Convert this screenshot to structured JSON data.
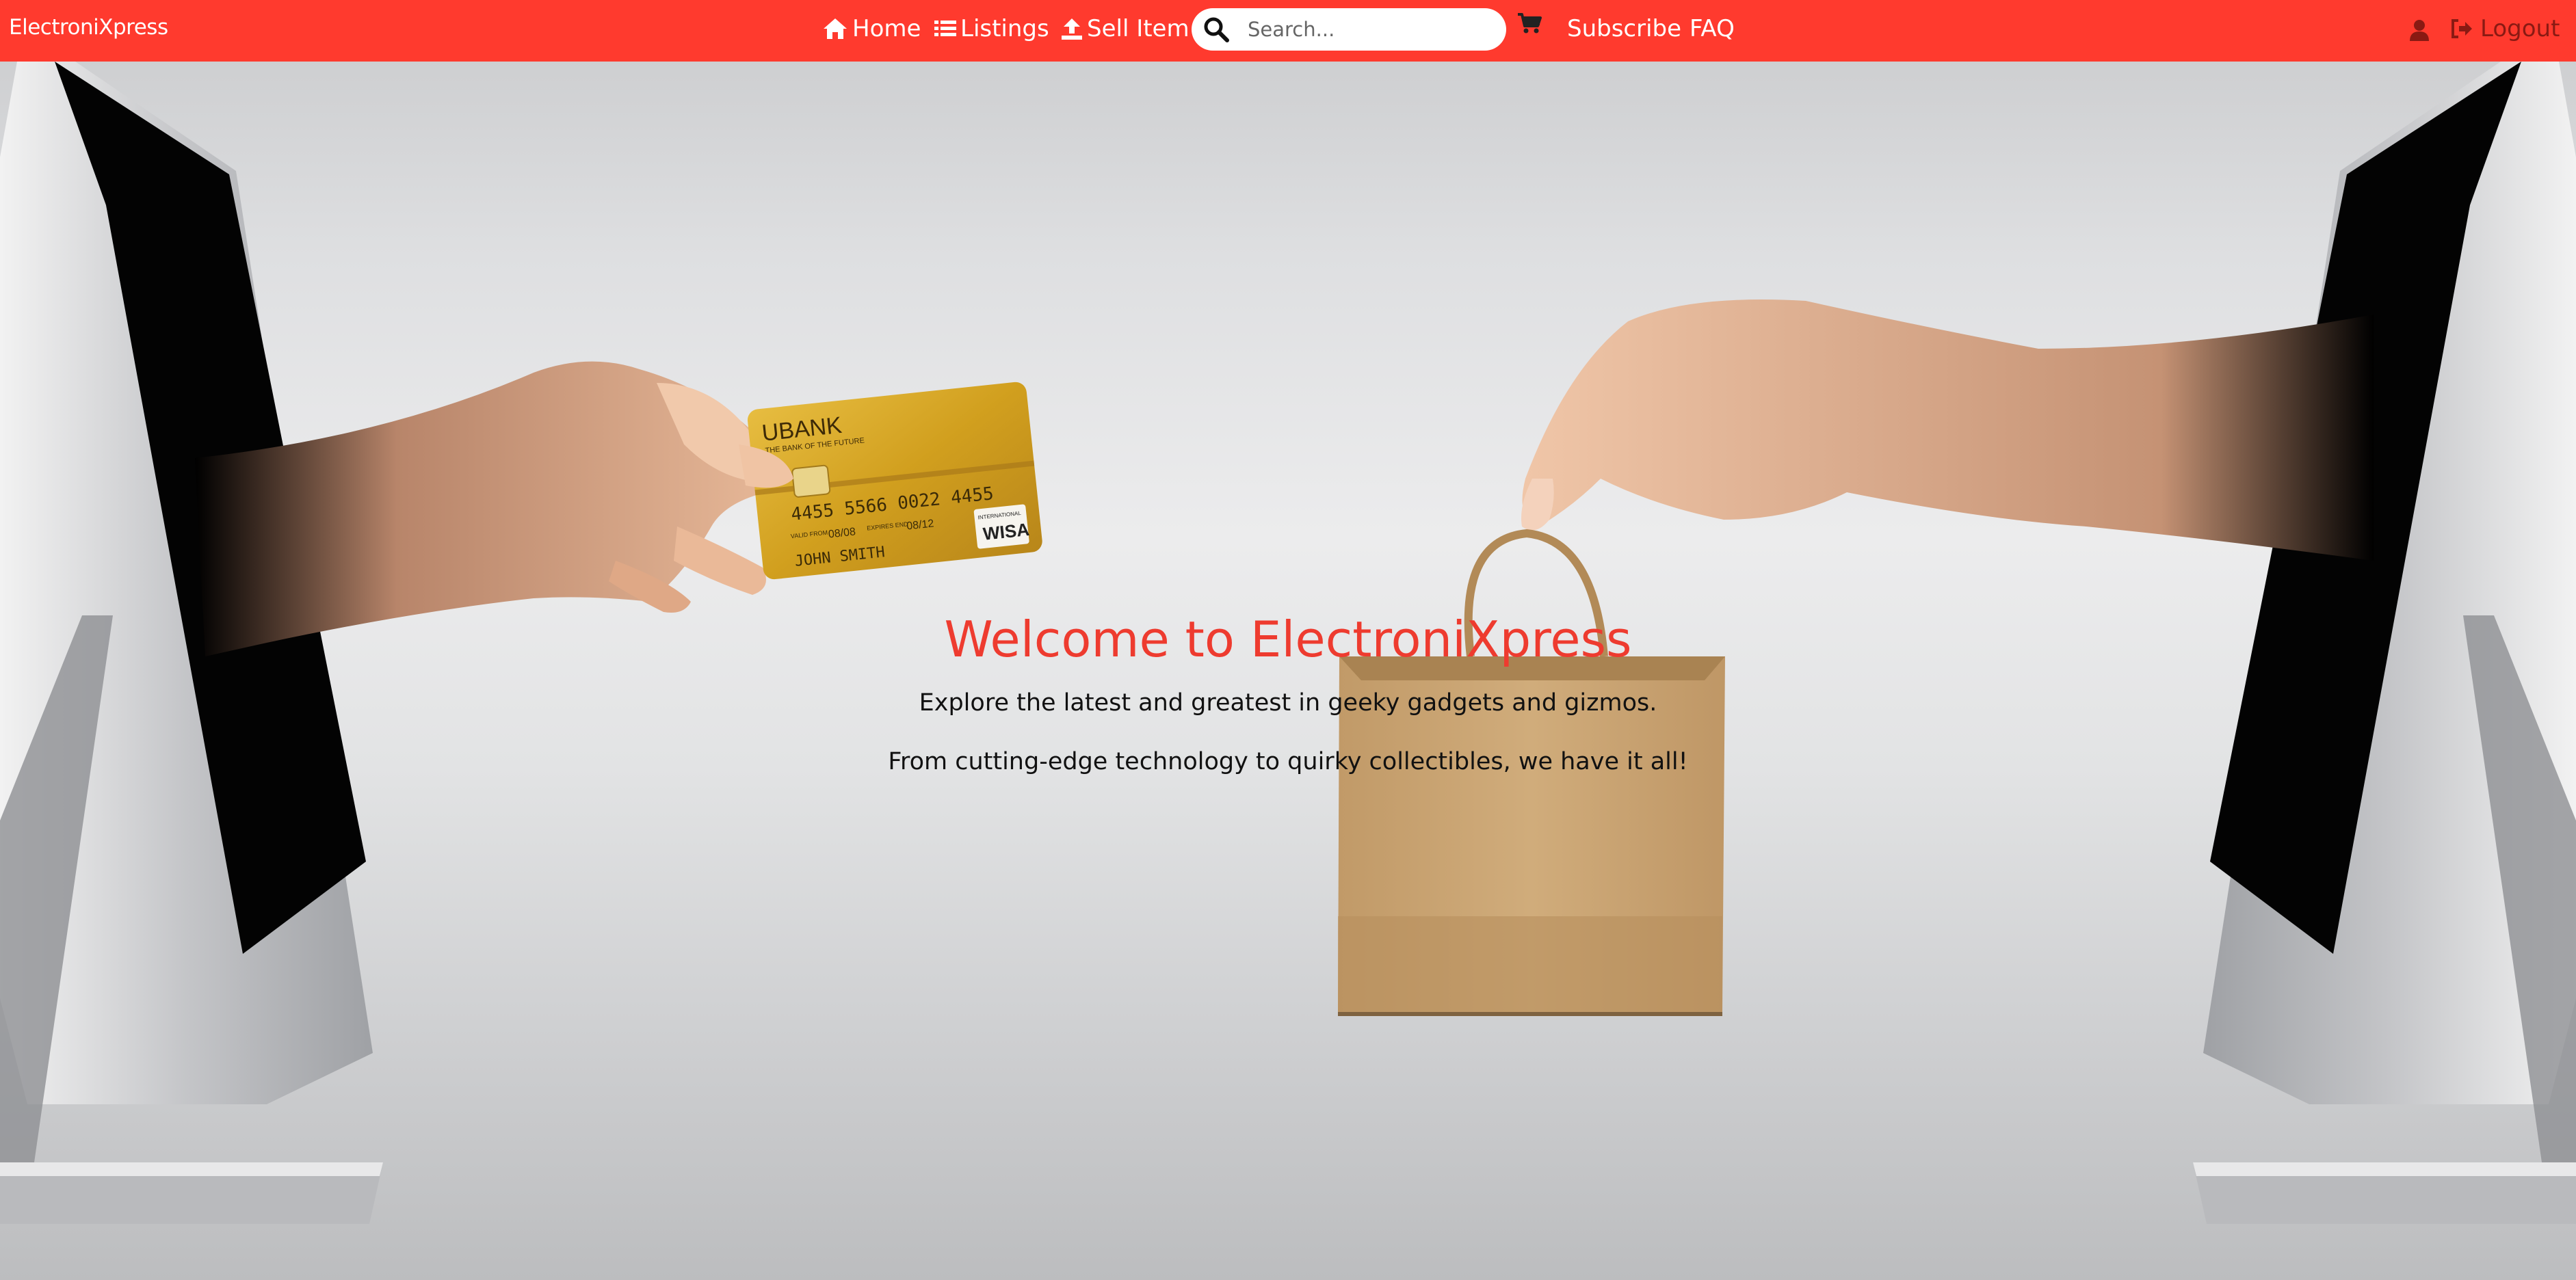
{
  "nav": {
    "brand": "ElectroniXpress",
    "home_label": "Home",
    "listings_label": "Listings",
    "sell_label": "Sell Item",
    "search_placeholder": "Search...",
    "subscribe_label": "Subscribe",
    "faq_label": "FAQ",
    "logout_label": "Logout",
    "icons": [
      "home-icon",
      "list-icon",
      "upload-icon",
      "search-icon",
      "cart-icon",
      "user-icon",
      "logout-icon"
    ]
  },
  "hero": {
    "title": "Welcome to ElectroniXpress",
    "line1": "Explore the latest and greatest in geeky gadgets and gizmos.",
    "line2": "From cutting-edge technology to quirky collectibles, we have it all!"
  },
  "card": {
    "bank": "UBANK",
    "tagline": "THE BANK OF THE FUTURE",
    "number": "4455 5566 0022 4455",
    "valid_label": "VALID FROM",
    "valid": "08/08",
    "expires_label": "EXPIRES END",
    "expires": "08/12",
    "holder": "JOHN SMITH",
    "network_small": "INTERNATIONAL",
    "network": "WISA"
  },
  "colors": {
    "accent": "#ff3a2e",
    "title": "#ee3b2f"
  }
}
